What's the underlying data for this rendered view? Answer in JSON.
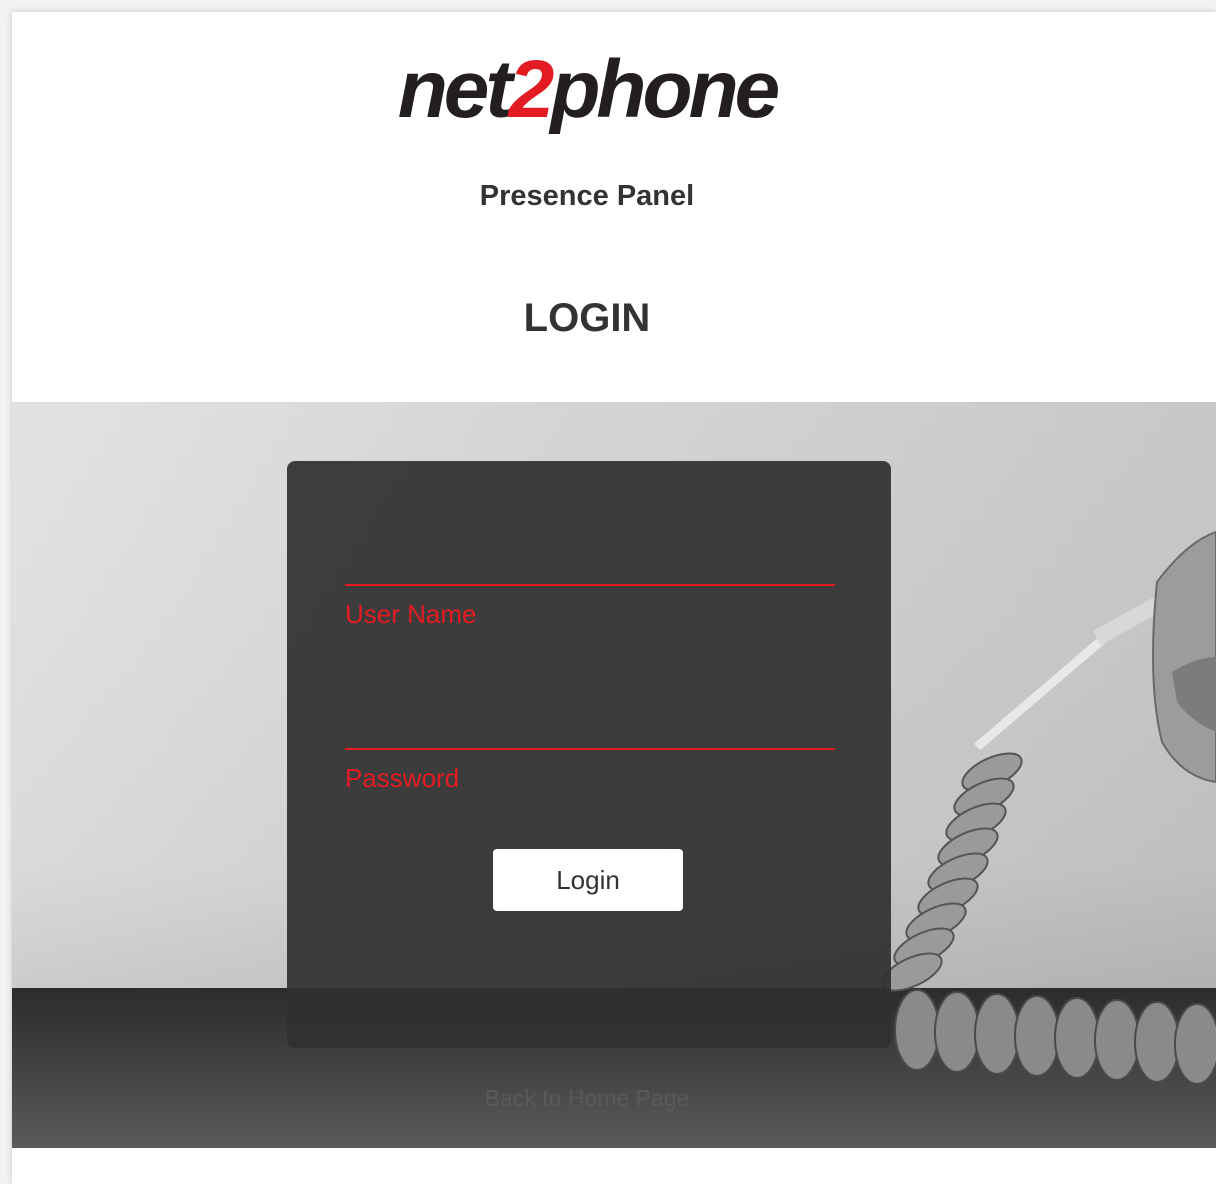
{
  "header": {
    "logo_prefix": "net",
    "logo_number": "2",
    "logo_suffix": "phone",
    "app_name": "Presence Panel",
    "page_heading": "LOGIN"
  },
  "form": {
    "username_placeholder": "User Name",
    "password_placeholder": "Password",
    "submit_label": "Login"
  },
  "footer": {
    "back_link": "Back to Home Page"
  },
  "colors": {
    "accent": "#e31b23",
    "logo_text": "#231f20",
    "card_bg": "#303030",
    "button_bg": "#ffffff"
  },
  "icons": {
    "background_image": "telephone-handset-photo"
  }
}
